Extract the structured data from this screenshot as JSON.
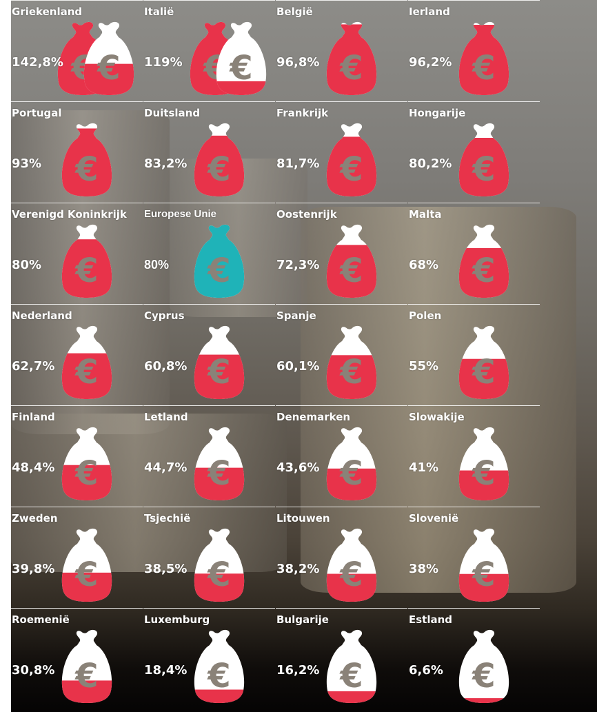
{
  "colors": {
    "debt_red": "#e8334a",
    "bag_white": "#ffffff",
    "eu_teal": "#1fb3b8",
    "euro_sign": "#8a8278"
  },
  "icon": "money-bag-euro-icon",
  "eu_name": "Europese Unie",
  "eu_value": "80%",
  "countries": [
    {
      "name": "Griekenland",
      "value": "142,8%",
      "debt_ratio": 1.428
    },
    {
      "name": "Italië",
      "value": "119%",
      "debt_ratio": 1.19
    },
    {
      "name": "België",
      "value": "96,8%",
      "debt_ratio": 0.968
    },
    {
      "name": "Ierland",
      "value": "96,2%",
      "debt_ratio": 0.962
    },
    {
      "name": "Portugal",
      "value": "93%",
      "debt_ratio": 0.93
    },
    {
      "name": "Duitsland",
      "value": "83,2%",
      "debt_ratio": 0.832
    },
    {
      "name": "Frankrijk",
      "value": "81,7%",
      "debt_ratio": 0.817
    },
    {
      "name": "Hongarije",
      "value": "80,2%",
      "debt_ratio": 0.802
    },
    {
      "name": "Verenigd Koninkrijk",
      "value": "80%",
      "debt_ratio": 0.8
    },
    {
      "name": "Oostenrijk",
      "value": "72,3%",
      "debt_ratio": 0.723
    },
    {
      "name": "Malta",
      "value": "68%",
      "debt_ratio": 0.68
    },
    {
      "name": "Nederland",
      "value": "62,7%",
      "debt_ratio": 0.627
    },
    {
      "name": "Cyprus",
      "value": "60,8%",
      "debt_ratio": 0.608
    },
    {
      "name": "Spanje",
      "value": "60,1%",
      "debt_ratio": 0.601
    },
    {
      "name": "Polen",
      "value": "55%",
      "debt_ratio": 0.55
    },
    {
      "name": "Finland",
      "value": "48,4%",
      "debt_ratio": 0.484
    },
    {
      "name": "Letland",
      "value": "44,7%",
      "debt_ratio": 0.447
    },
    {
      "name": "Denemarken",
      "value": "43,6%",
      "debt_ratio": 0.436
    },
    {
      "name": "Slowakije",
      "value": "41%",
      "debt_ratio": 0.41
    },
    {
      "name": "Zweden",
      "value": "39,8%",
      "debt_ratio": 0.398
    },
    {
      "name": "Tsjechië",
      "value": "38,5%",
      "debt_ratio": 0.385
    },
    {
      "name": "Litouwen",
      "value": "38,2%",
      "debt_ratio": 0.382
    },
    {
      "name": "Slovenië",
      "value": "38%",
      "debt_ratio": 0.38
    },
    {
      "name": "Roemenië",
      "value": "30,8%",
      "debt_ratio": 0.308
    },
    {
      "name": "Luxemburg",
      "value": "18,4%",
      "debt_ratio": 0.184
    },
    {
      "name": "Bulgarije",
      "value": "16,2%",
      "debt_ratio": 0.162
    },
    {
      "name": "Estland",
      "value": "6,6%",
      "debt_ratio": 0.066
    }
  ]
}
